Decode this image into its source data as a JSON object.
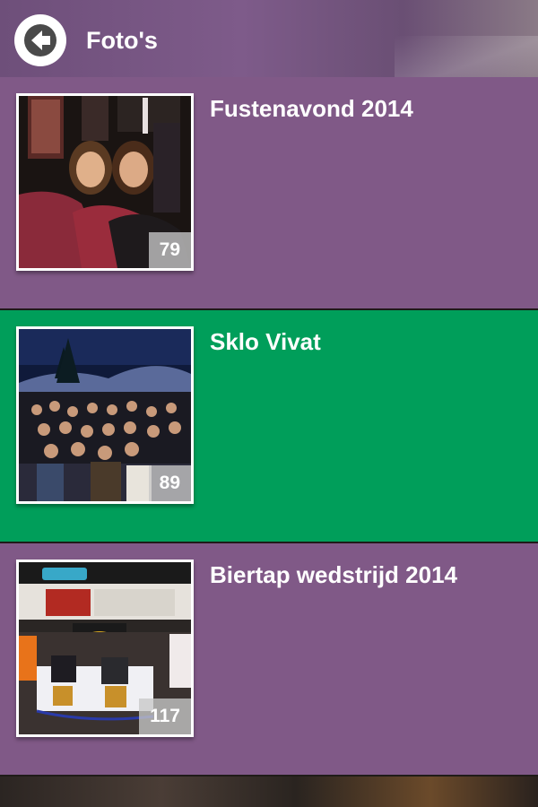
{
  "header": {
    "title": "Foto's",
    "back_icon": "arrow-left-icon"
  },
  "albums": [
    {
      "title": "Fustenavond 2014",
      "count": "79",
      "color": "#805987"
    },
    {
      "title": "Sklo Vivat",
      "count": "89",
      "color": "#009e5a"
    },
    {
      "title": "Biertap wedstrijd 2014",
      "count": "117",
      "color": "#805987"
    }
  ]
}
